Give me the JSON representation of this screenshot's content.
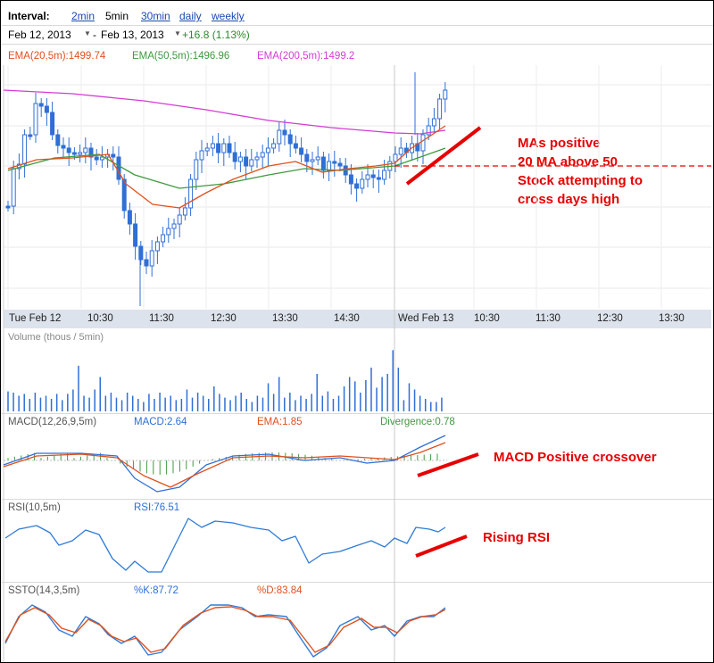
{
  "toolbar": {
    "interval_label": "Interval:",
    "intervals": [
      "2min",
      "5min",
      "30min",
      "daily",
      "weekly"
    ],
    "selected_interval": "5min",
    "date_from": "Feb 12, 2013",
    "date_dash": "-",
    "date_to": "Feb 13, 2013",
    "change": "+16.8 (1.13%)",
    "dropdown_icon": "chevron-down-icon"
  },
  "colors": {
    "ema20": "#e0501c",
    "ema50": "#3f9a3f",
    "ema200": "#d43cd4",
    "candle": "#2f6fd6",
    "rsi": "#2f7bd6",
    "sstok": "#2f7bd6",
    "sstod": "#e0501c",
    "annotation": "#e60000",
    "positive": "#2a8a2a",
    "link": "#1a49b5"
  },
  "price_panel": {
    "legend": [
      {
        "text": "EMA(20,5m):1499.74",
        "color": "#e0501c"
      },
      {
        "text": "EMA(50,5m):1496.96",
        "color": "#3f9a3f"
      },
      {
        "text": "EMA(200,5m):1499.2",
        "color": "#d43cd4"
      }
    ]
  },
  "time_axis": {
    "labels": [
      "Tue Feb 12",
      "10:30",
      "11:30",
      "12:30",
      "13:30",
      "14:30",
      "Wed Feb 13",
      "10:30",
      "11:30",
      "12:30",
      "13:30"
    ]
  },
  "volume_panel": {
    "label": "Volume (thous / 5min)"
  },
  "macd_panel": {
    "label": "MACD(12,26,9,5m)",
    "macd": "MACD:2.64",
    "ema": "EMA:1.85",
    "divergence": "Divergence:0.78"
  },
  "rsi_panel": {
    "label": "RSI(10,5m)",
    "value": "RSI:76.51"
  },
  "ssto_panel": {
    "label": "SSTO(14,3,5m)",
    "k": "%K:87.72",
    "d": "%D:83.84"
  },
  "annotations": {
    "ma": [
      "MAs positive",
      "20 MA above 50",
      "Stock attempting to",
      "cross days high"
    ],
    "macd": "MACD Positive crossover",
    "rsi": "Rising RSI"
  },
  "chart_data": [
    {
      "type": "line",
      "title": "",
      "note": "Intraday candlestick price chart, 5-minute bars, Feb 12–13 2013",
      "series": [
        {
          "name": "EMA(20,5m)",
          "last": 1499.74
        },
        {
          "name": "EMA(50,5m)",
          "last": 1496.96
        },
        {
          "name": "EMA(200,5m)",
          "last": 1499.2
        }
      ],
      "x_ticks": [
        "Tue Feb 12",
        "10:30",
        "11:30",
        "12:30",
        "13:30",
        "14:30",
        "Wed Feb 13",
        "10:30",
        "11:30",
        "12:30",
        "13:30"
      ],
      "grid": true
    },
    {
      "type": "bar",
      "title": "Volume (thous / 5min)",
      "values": [
        32,
        30,
        25,
        28,
        20,
        30,
        22,
        25,
        20,
        28,
        18,
        28,
        35,
        73,
        25,
        22,
        35,
        55,
        25,
        30,
        22,
        18,
        30,
        25,
        20,
        15,
        28,
        20,
        30,
        22,
        25,
        18,
        20,
        35,
        22,
        30,
        25,
        20,
        40,
        28,
        22,
        18,
        25,
        30,
        20,
        15,
        25,
        22,
        45,
        28,
        55,
        22,
        30,
        18,
        25,
        20,
        28,
        60,
        25,
        32,
        20,
        25,
        40,
        55,
        48,
        30,
        50,
        70,
        38,
        55,
        60,
        98,
        70,
        18,
        45,
        35,
        25,
        20,
        15,
        15,
        22
      ]
    },
    {
      "type": "line",
      "title": "MACD(12,26,9,5m)",
      "series": [
        {
          "name": "MACD",
          "last": 2.64
        },
        {
          "name": "EMA",
          "last": 1.85
        },
        {
          "name": "Divergence",
          "last": 0.78
        }
      ]
    },
    {
      "type": "line",
      "title": "RSI(10,5m)",
      "series": [
        {
          "name": "RSI",
          "last": 76.51
        }
      ]
    },
    {
      "type": "line",
      "title": "SSTO(14,3,5m)",
      "series": [
        {
          "name": "%K",
          "last": 87.72
        },
        {
          "name": "%D",
          "last": 83.84
        }
      ]
    }
  ]
}
